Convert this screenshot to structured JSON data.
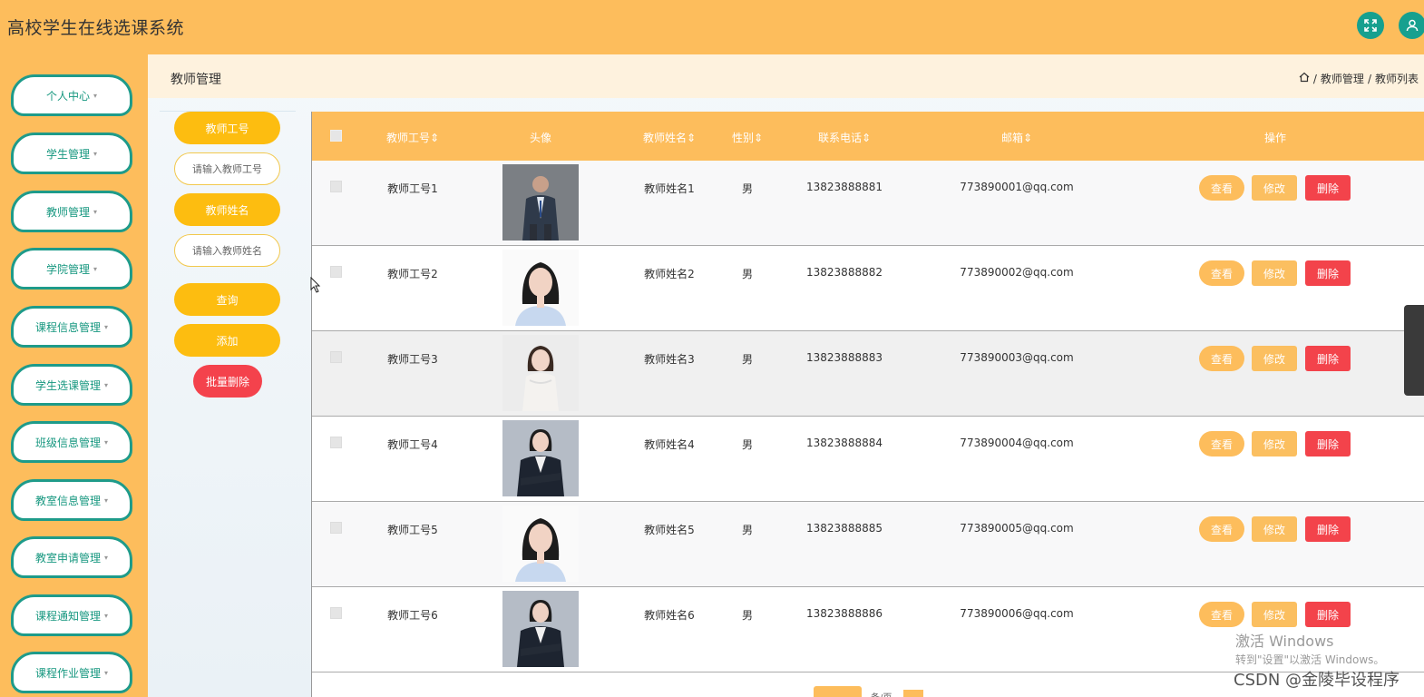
{
  "app": {
    "title": "高校学生在线选课系统"
  },
  "topbar": {
    "icons": [
      "expand-icon",
      "user-icon"
    ]
  },
  "sidebar": {
    "items": [
      {
        "label": "个人中心"
      },
      {
        "label": "学生管理"
      },
      {
        "label": "教师管理"
      },
      {
        "label": "学院管理"
      },
      {
        "label": "课程信息管理"
      },
      {
        "label": "学生选课管理"
      },
      {
        "label": "班级信息管理"
      },
      {
        "label": "教室信息管理"
      },
      {
        "label": "教室申请管理"
      },
      {
        "label": "课程通知管理"
      },
      {
        "label": "课程作业管理"
      }
    ]
  },
  "page": {
    "title": "教师管理",
    "breadcrumb": {
      "level1": "教师管理",
      "level2": "教师列表",
      "sep": "/"
    }
  },
  "search": {
    "teacher_no_label": "教师工号",
    "teacher_no_placeholder": "请输入教师工号",
    "teacher_name_label": "教师姓名",
    "teacher_name_placeholder": "请输入教师姓名",
    "query_label": "查询",
    "add_label": "添加",
    "batch_delete_label": "批量删除"
  },
  "table": {
    "columns": {
      "teacher_no": "教师工号",
      "avatar": "头像",
      "teacher_name": "教师姓名",
      "gender": "性别",
      "phone": "联系电话",
      "email": "邮箱",
      "actions": "操作"
    },
    "sort_icon": "⇕",
    "actions": {
      "view": "查看",
      "edit": "修改",
      "delete": "删除"
    },
    "rows": [
      {
        "teacher_no": "教师工号1",
        "teacher_name": "教师姓名1",
        "gender": "男",
        "phone": "13823888881",
        "email": "773890001@qq.com"
      },
      {
        "teacher_no": "教师工号2",
        "teacher_name": "教师姓名2",
        "gender": "男",
        "phone": "13823888882",
        "email": "773890002@qq.com"
      },
      {
        "teacher_no": "教师工号3",
        "teacher_name": "教师姓名3",
        "gender": "男",
        "phone": "13823888883",
        "email": "773890003@qq.com"
      },
      {
        "teacher_no": "教师工号4",
        "teacher_name": "教师姓名4",
        "gender": "男",
        "phone": "13823888884",
        "email": "773890004@qq.com"
      },
      {
        "teacher_no": "教师工号5",
        "teacher_name": "教师姓名5",
        "gender": "男",
        "phone": "13823888885",
        "email": "773890005@qq.com"
      },
      {
        "teacher_no": "教师工号6",
        "teacher_name": "教师姓名6",
        "gender": "男",
        "phone": "13823888886",
        "email": "773890006@qq.com"
      }
    ]
  },
  "pagination": {
    "text": "条/页"
  },
  "watermark": {
    "line1": "激活 Windows",
    "line2": "转到\"设置\"以激活 Windows。"
  },
  "csdn": "CSDN @金陵毕设程序",
  "colors": {
    "orange": "#fdbd5c",
    "teal": "#16a08f",
    "danger": "#f3434b",
    "yellow": "#fdbd10"
  }
}
